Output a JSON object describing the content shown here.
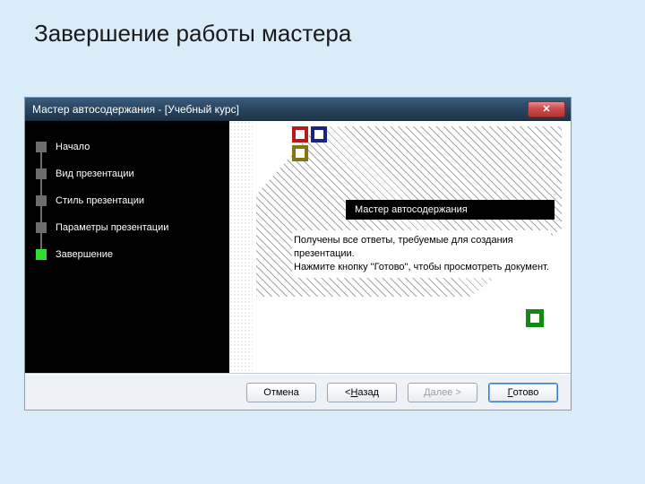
{
  "slide_title": "Завершение работы мастера",
  "window_title": "Мастер автосодержания - [Учебный курс]",
  "steps": {
    "s0": "Начало",
    "s1": "Вид презентации",
    "s2": "Стиль презентации",
    "s3": "Параметры презентации",
    "s4": "Завершение"
  },
  "preview_header": "Мастер автосодержания",
  "preview_line1": "Получены все ответы, требуемые для создания презентации.",
  "preview_line2": "Нажмите кнопку \"Готово\", чтобы просмотреть документ.",
  "buttons": {
    "cancel": "Отмена",
    "back_prefix": "< ",
    "back_ul": "Н",
    "back_rest": "азад",
    "next_ul": "Д",
    "next_rest": "алее >",
    "finish_ul": "Г",
    "finish_rest": "отово"
  }
}
